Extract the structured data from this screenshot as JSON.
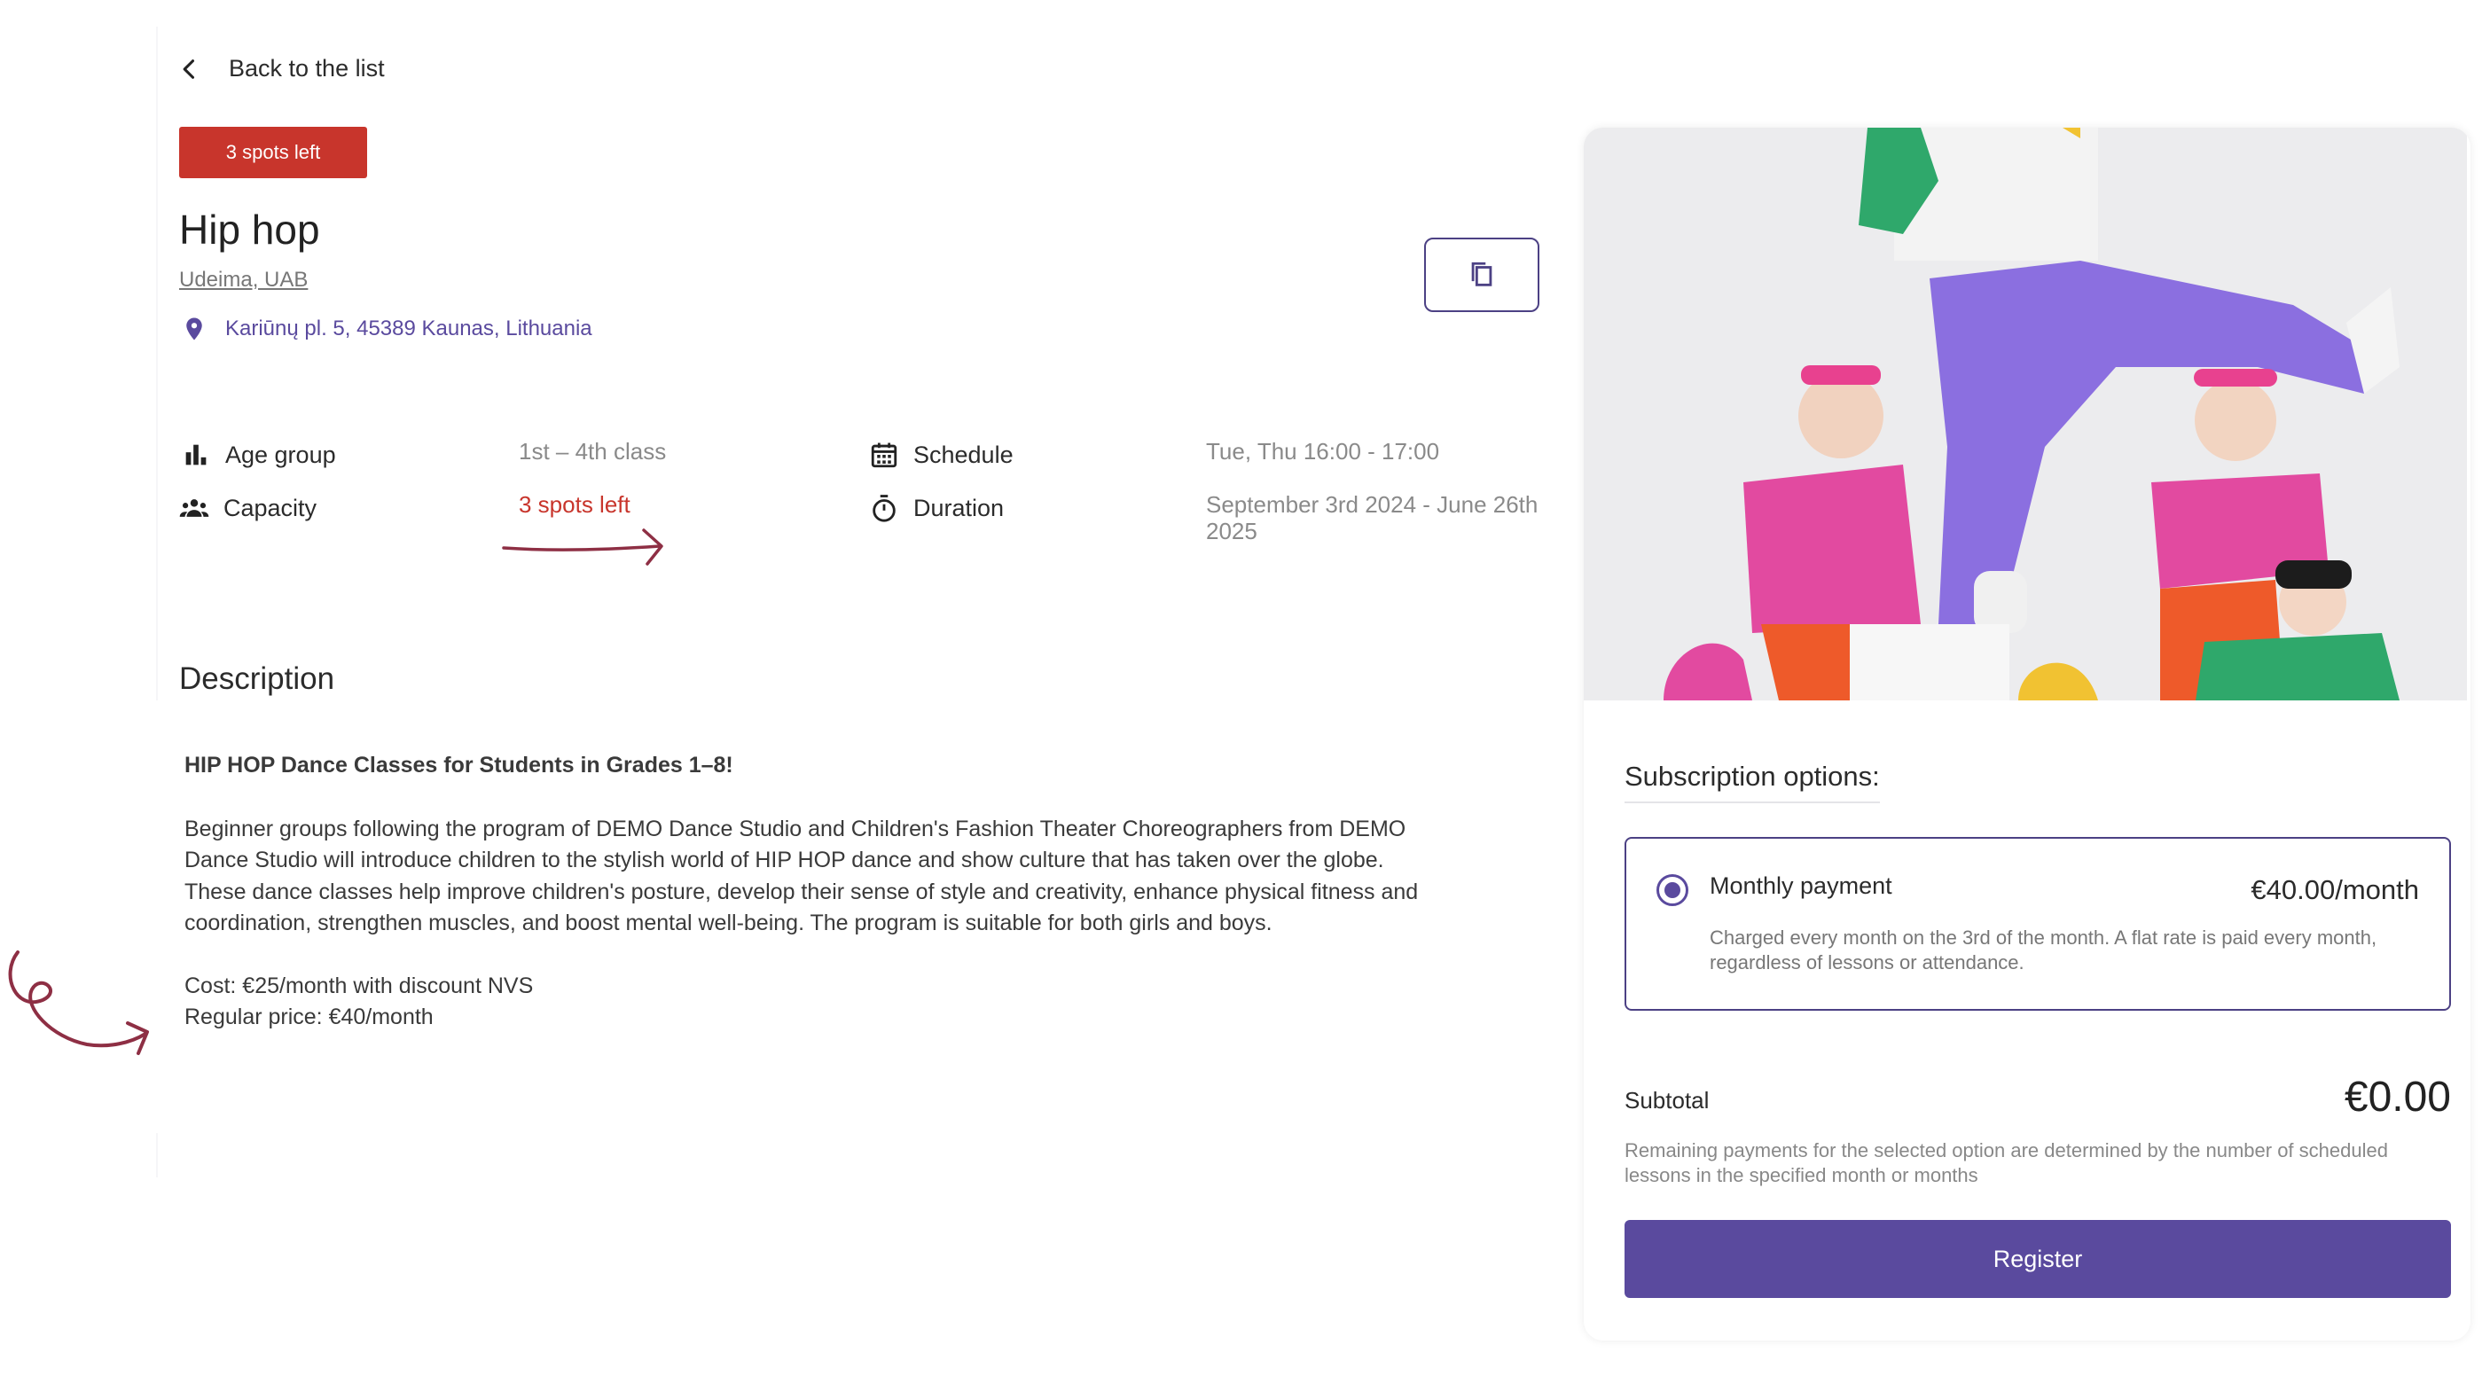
{
  "nav": {
    "back_label": "Back to the list"
  },
  "badge": {
    "label": "3 spots left",
    "color": "#c8352c"
  },
  "activity": {
    "title": "Hip hop",
    "organizer": "Udeima, UAB",
    "address": "Kariūnų pl. 5, 45389 Kaunas, Lithuania"
  },
  "info": {
    "age_group_label": "Age group",
    "age_group_value": "1st – 4th class",
    "capacity_label": "Capacity",
    "capacity_value": "3 spots left",
    "schedule_label": "Schedule",
    "schedule_value": "Tue, Thu 16:00 - 17:00",
    "duration_label": "Duration",
    "duration_value": "September 3rd 2024 - June 26th 2025"
  },
  "description": {
    "heading": "Description",
    "title": "HIP HOP Dance Classes for Students in Grades 1–8!",
    "paragraph": "Beginner groups following the program of DEMO Dance Studio and Children's Fashion Theater Choreographers from DEMO Dance Studio will introduce children to the stylish world of HIP HOP dance and show culture that has taken over the globe. These dance classes help improve children's posture, develop their sense of style and creativity, enhance physical fitness and coordination, strengthen muscles, and boost mental well-being. The program is suitable for both girls and boys.",
    "cost_line": "Cost: €25/month with discount NVS",
    "regular_line": "Regular price: €40/month"
  },
  "subscription": {
    "heading": "Subscription options:",
    "option_name": "Monthly payment",
    "option_price": "€40.00/month",
    "option_desc": "Charged every month on the 3rd of the month. A flat rate is paid every month, regardless of lessons or attendance.",
    "subtotal_label": "Subtotal",
    "subtotal_value": "€0.00",
    "note": "Remaining payments for the selected option are determined by the number of scheduled lessons in the specified month or months",
    "register_label": "Register"
  },
  "colors": {
    "accent": "#5a4a9e",
    "danger": "#c8352c",
    "annotation": "#8e2f44"
  }
}
